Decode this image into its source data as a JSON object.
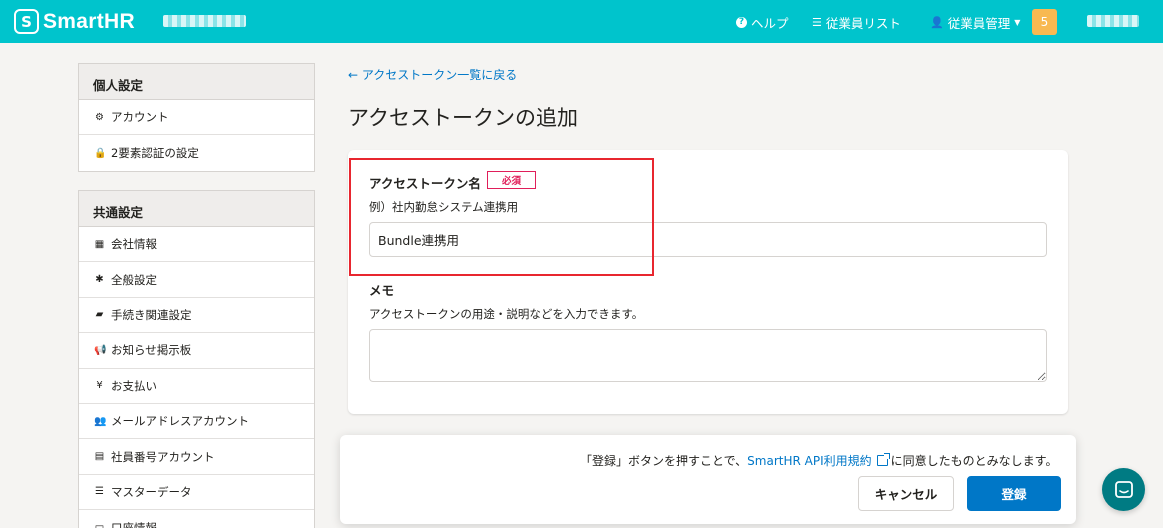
{
  "header": {
    "logo_mark": "S",
    "logo_text": "SmartHR",
    "help_icon": "question-circle-icon",
    "help_label": "ヘルプ",
    "employee_list_icon": "list-icon",
    "employee_list_label": "従業員リスト",
    "employee_mgmt_icon": "user-icon",
    "employee_mgmt_label": "従業員管理",
    "notification_count": "5",
    "accent_color": "#00c4cc"
  },
  "sidebar": {
    "personal": {
      "heading": "個人設定",
      "items": [
        {
          "label": "アカウント",
          "icon": "gear-icon"
        },
        {
          "label": "2要素認証の設定",
          "icon": "lock-icon"
        }
      ]
    },
    "common": {
      "heading": "共通設定",
      "items": [
        {
          "label": "会社情報",
          "icon": "building-icon"
        },
        {
          "label": "全般設定",
          "icon": "asterisk-icon"
        },
        {
          "label": "手続き関連設定",
          "icon": "book-icon"
        },
        {
          "label": "お知らせ掲示板",
          "icon": "megaphone-icon"
        },
        {
          "label": "お支払い",
          "icon": "yen-icon"
        },
        {
          "label": "メールアドレスアカウント",
          "icon": "users-icon"
        },
        {
          "label": "社員番号アカウント",
          "icon": "id-card-icon"
        },
        {
          "label": "マスターデータ",
          "icon": "database-icon"
        },
        {
          "label": "口座情報",
          "icon": "card-icon"
        }
      ]
    }
  },
  "main": {
    "back_link": "アクセストークン一覧に戻る",
    "title": "アクセストークンの追加",
    "token_name": {
      "label": "アクセストークン名",
      "required_badge": "必須",
      "hint": "例）社内勤怠システム連携用",
      "value": "Bundle連携用"
    },
    "memo": {
      "label": "メモ",
      "hint": "アクセストークンの用途・説明などを入力できます。",
      "value": ""
    }
  },
  "footer": {
    "consent_prefix": "「登録」ボタンを押すことで、",
    "consent_link": "SmartHR API利用規約",
    "consent_suffix": "に同意したものとみなします。",
    "cancel_label": "キャンセル",
    "submit_label": "登録",
    "primary_color": "#0077c7"
  },
  "annotation": {
    "highlight_color": "#e8262f"
  }
}
